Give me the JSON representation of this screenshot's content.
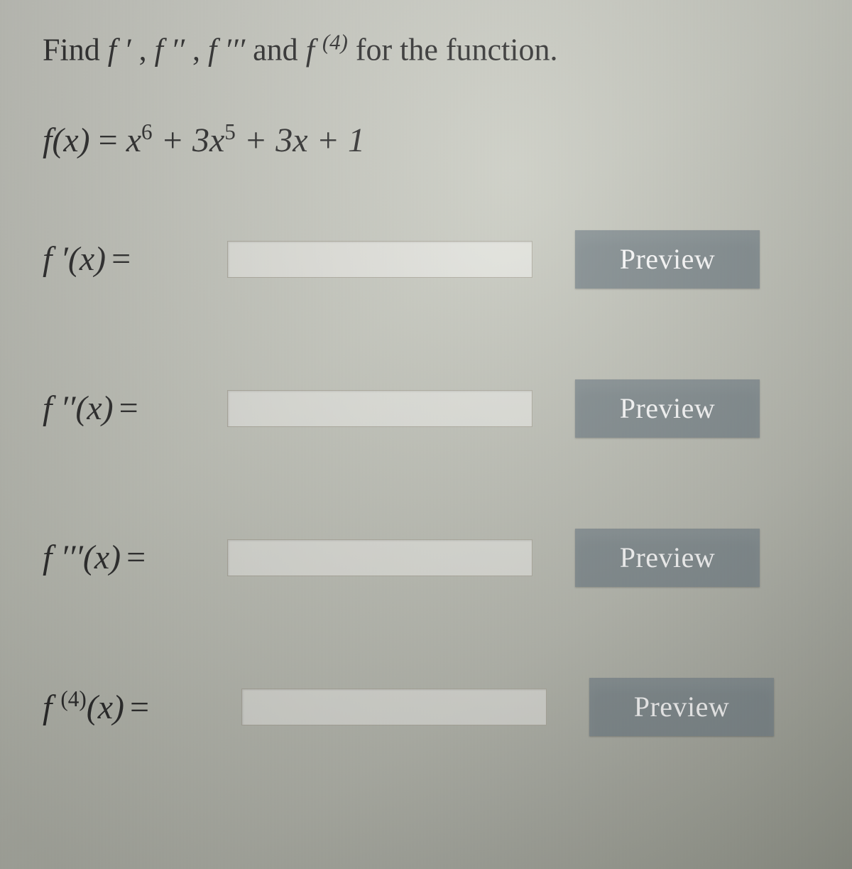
{
  "prompt": {
    "prefix": "Find ",
    "f1": "f ′",
    "sep1": ", ",
    "f2": "f ′′",
    "sep2": ", ",
    "f3": "f ′′′",
    "and": " and ",
    "f4_base": "f ",
    "f4_sup": "(4)",
    "suffix": " for the function."
  },
  "function_def": {
    "lhs": "f(x)",
    "eq": " = ",
    "rhs_html_terms": [
      "x",
      "6",
      " + 3x",
      "5",
      " + 3x + 1"
    ]
  },
  "rows": [
    {
      "id": "d1",
      "label_base": "f ′(x)",
      "label_sup": "",
      "button": "Preview",
      "value": ""
    },
    {
      "id": "d2",
      "label_base": "f ′′(x)",
      "label_sup": "",
      "button": "Preview",
      "value": ""
    },
    {
      "id": "d3",
      "label_base": "f ′′′(x)",
      "label_sup": "",
      "button": "Preview",
      "value": ""
    },
    {
      "id": "d4",
      "label_base": "f ",
      "label_sup": "(4)",
      "label_after_sup": "(x)",
      "button": "Preview",
      "value": ""
    }
  ],
  "colors": {
    "button_bg": "#7f8a8d",
    "button_text": "#fefefe"
  }
}
